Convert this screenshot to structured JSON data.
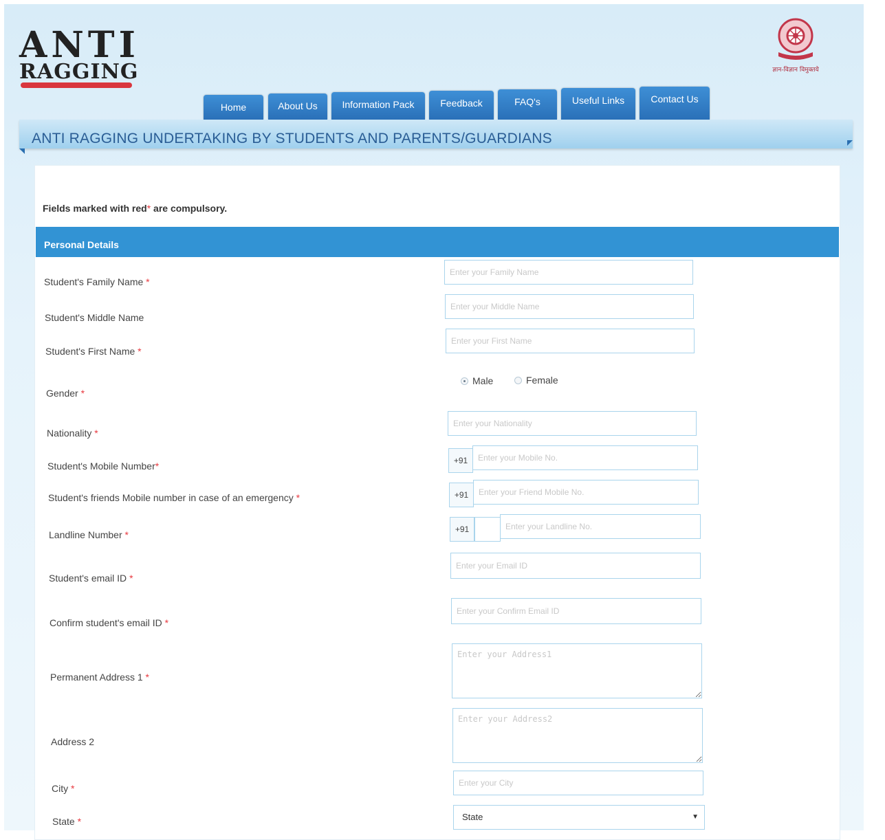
{
  "header": {
    "logo_line1": "ANTI",
    "logo_line2": "RAGGING",
    "emblem_caption": "ज्ञान-विज्ञान विमुक्तये"
  },
  "nav": {
    "tabs": [
      {
        "label": "Home"
      },
      {
        "label": "About Us"
      },
      {
        "label": "Information Pack"
      },
      {
        "label": "Feedback"
      },
      {
        "label": "FAQ's"
      },
      {
        "label": "Useful Links"
      },
      {
        "label": "Contact Us"
      }
    ]
  },
  "page_title": "ANTI RAGGING UNDERTAKING BY STUDENTS AND PARENTS/GUARDIANS",
  "notice": {
    "text_before": "Fields marked with red",
    "star": "*",
    "text_after": " are compulsory."
  },
  "section": {
    "title": "Personal Details"
  },
  "form": {
    "family_name": {
      "label": "Student's Family Name",
      "required": "*",
      "placeholder": "Enter your Family Name"
    },
    "middle_name": {
      "label": "Student's Middle Name",
      "placeholder": "Enter your Middle Name"
    },
    "first_name": {
      "label": "Student's First Name",
      "required": "*",
      "placeholder": "Enter your First Name"
    },
    "gender": {
      "label": "Gender",
      "required": "*",
      "option_male": "Male",
      "option_female": "Female",
      "selected": "Male"
    },
    "nationality": {
      "label": "Nationality",
      "required": "*",
      "placeholder": "Enter your Nationality"
    },
    "mobile": {
      "label": "Student's Mobile Number",
      "required": "*",
      "prefix": "+91",
      "placeholder": "Enter your Mobile No."
    },
    "friend_mobile": {
      "label": "Student's friends Mobile number in case of an emergency",
      "required": "*",
      "prefix": "+91",
      "placeholder": "Enter your Friend Mobile No."
    },
    "landline": {
      "label": "Landline Number",
      "required": "*",
      "prefix": "+91",
      "placeholder": "Enter your Landline No."
    },
    "email": {
      "label": "Student's email ID",
      "required": "*",
      "placeholder": "Enter your Email ID"
    },
    "confirm_email": {
      "label": "Confirm student's email ID",
      "required": "*",
      "placeholder": "Enter your Confirm Email ID"
    },
    "address1": {
      "label": "Permanent Address 1",
      "required": "*",
      "placeholder": "Enter your Address1"
    },
    "address2": {
      "label": "Address 2",
      "placeholder": "Enter your Address2"
    },
    "city": {
      "label": "City",
      "required": "*",
      "placeholder": "Enter your City"
    },
    "state": {
      "label": "State",
      "required": "*",
      "selected": "State"
    }
  },
  "colors": {
    "nav_tab": "#2f7cc6",
    "section_bar": "#3293d4",
    "required": "#e8393f",
    "title": "#2a5d95"
  }
}
